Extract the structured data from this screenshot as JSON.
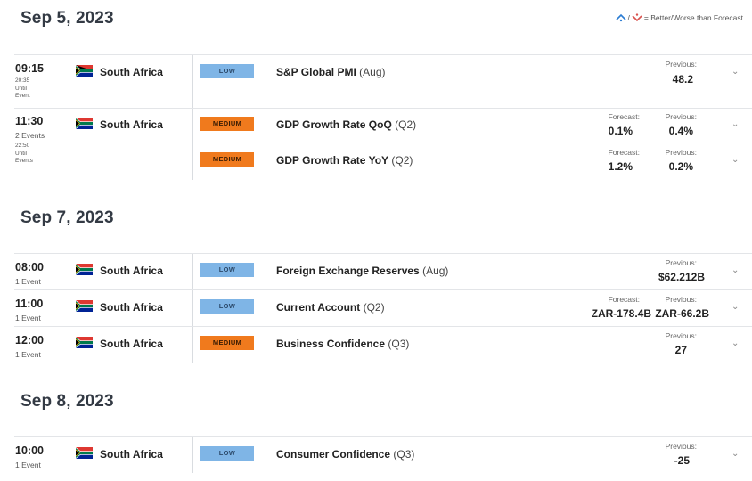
{
  "legend": {
    "text": "= Better/Worse than Forecast",
    "better_color": "#2b7cd3",
    "worse_color": "#d9534f"
  },
  "days": [
    {
      "date": "Sep 5, 2023"
    },
    {
      "date": "Sep 7, 2023"
    },
    {
      "date": "Sep 8, 2023"
    }
  ],
  "rows": [
    {
      "time": "09:15",
      "events": "",
      "until_time": "20:35",
      "until_label1": "Until",
      "until_label2": "Event",
      "country": "South Africa",
      "impact": "LOW",
      "event": "S&P Global PMI",
      "period": "(Aug)",
      "forecast_label": "",
      "forecast": "",
      "previous_label": "Previous:",
      "previous": "48.2"
    },
    {
      "time": "11:30",
      "events": "2 Events",
      "until_time": "22:50",
      "until_label1": "Until",
      "until_label2": "Events",
      "country": "South Africa",
      "impact": "MEDIUM",
      "event": "GDP Growth Rate QoQ",
      "period": "(Q2)",
      "forecast_label": "Forecast:",
      "forecast": "0.1%",
      "previous_label": "Previous:",
      "previous": "0.4%"
    },
    {
      "impact": "MEDIUM",
      "event": "GDP Growth Rate YoY",
      "period": "(Q2)",
      "forecast_label": "Forecast:",
      "forecast": "1.2%",
      "previous_label": "Previous:",
      "previous": "0.2%"
    },
    {
      "time": "08:00",
      "events": "1 Event",
      "country": "South Africa",
      "impact": "LOW",
      "event": "Foreign Exchange Reserves",
      "period": "(Aug)",
      "forecast_label": "",
      "forecast": "",
      "previous_label": "Previous:",
      "previous": "$62.212B"
    },
    {
      "time": "11:00",
      "events": "1 Event",
      "country": "South Africa",
      "impact": "LOW",
      "event": "Current Account",
      "period": "(Q2)",
      "forecast_label": "Forecast:",
      "forecast": "ZAR-178.4B",
      "previous_label": "Previous:",
      "previous": "ZAR-66.2B"
    },
    {
      "time": "12:00",
      "events": "1 Event",
      "country": "South Africa",
      "impact": "MEDIUM",
      "event": "Business Confidence",
      "period": "(Q3)",
      "forecast_label": "",
      "forecast": "",
      "previous_label": "Previous:",
      "previous": "27"
    },
    {
      "time": "10:00",
      "events": "1 Event",
      "country": "South Africa",
      "impact": "LOW",
      "event": "Consumer Confidence",
      "period": "(Q3)",
      "forecast_label": "",
      "forecast": "",
      "previous_label": "Previous:",
      "previous": "-25"
    }
  ]
}
